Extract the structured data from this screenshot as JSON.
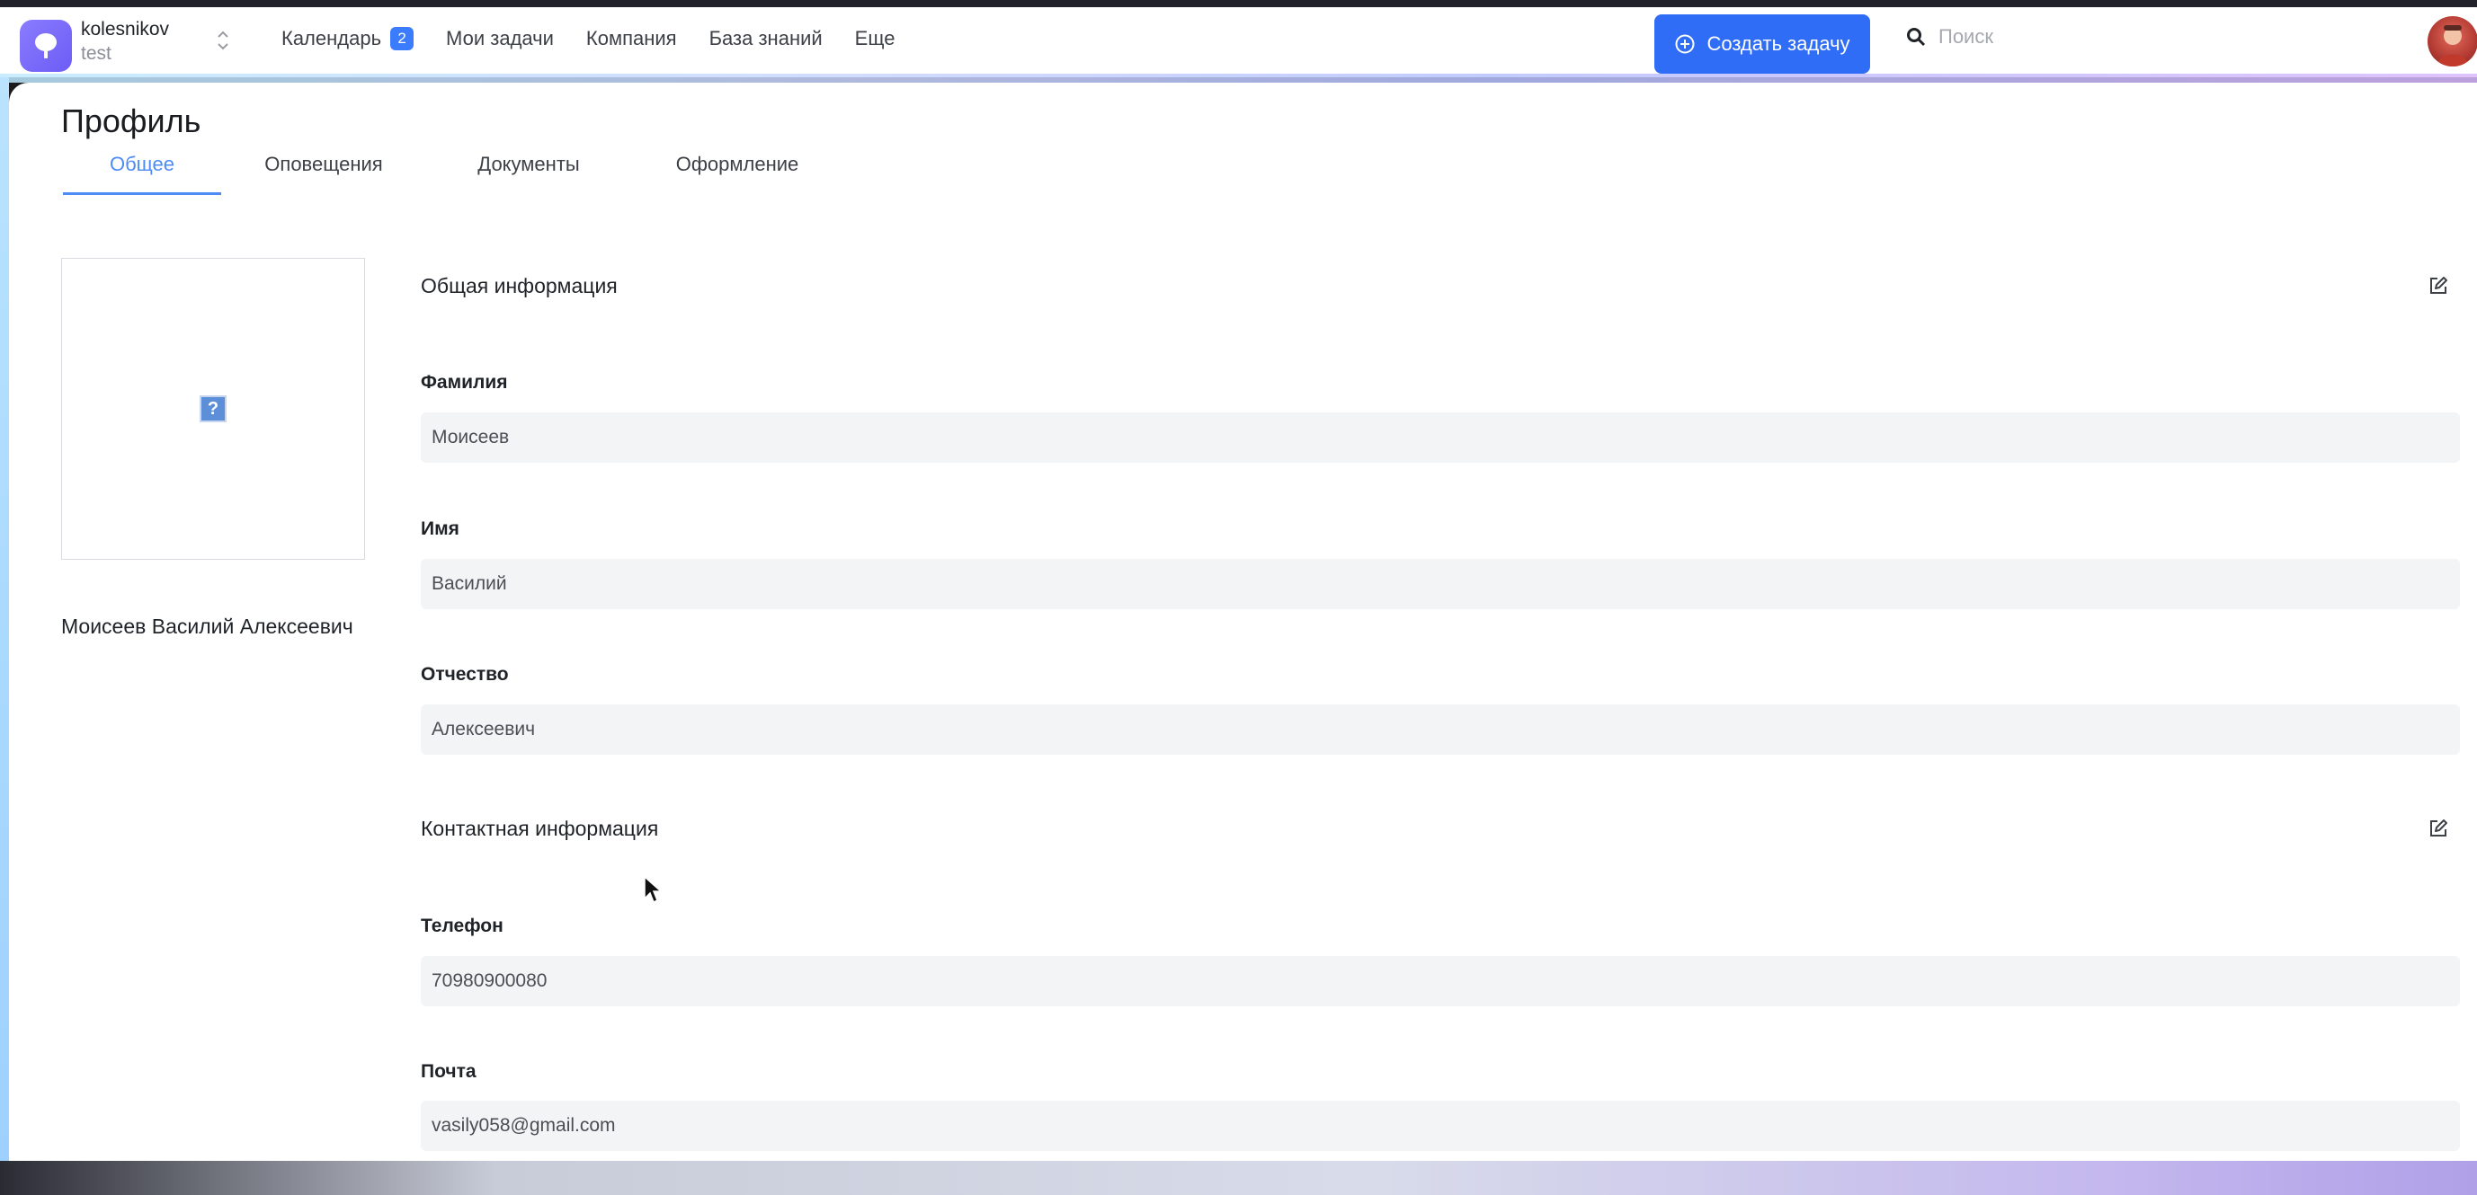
{
  "header": {
    "company_name": "kolesnikov",
    "company_sub": "test",
    "nav": [
      {
        "label": "Календарь",
        "badge": "2"
      },
      {
        "label": "Мои задачи"
      },
      {
        "label": "Компания"
      },
      {
        "label": "База знаний"
      },
      {
        "label": "Еще"
      }
    ],
    "create_label": "Создать задачу",
    "search_placeholder": "Поиск"
  },
  "page": {
    "title": "Профиль",
    "tabs": [
      "Общее",
      "Оповещения",
      "Документы",
      "Оформление"
    ],
    "active_tab": "Общее",
    "full_name": "Моисеев Василий Алексеевич"
  },
  "general": {
    "title": "Общая информация",
    "fields": [
      {
        "label": "Фамилия",
        "value": "Моисеев"
      },
      {
        "label": "Имя",
        "value": "Василий"
      },
      {
        "label": "Отчество",
        "value": "Алексеевич"
      }
    ]
  },
  "contact": {
    "title": "Контактная информация",
    "fields": [
      {
        "label": "Телефон",
        "value": "70980900080"
      },
      {
        "label": "Почта",
        "value": "vasily058@gmail.com"
      }
    ]
  },
  "colors": {
    "accent": "#2f6df6",
    "tab_active": "#4d8bf5",
    "logo": "#7b6cf8"
  },
  "icons": {
    "logo": "cloud-tree-icon",
    "switcher": "chevron-updown-icon",
    "create": "plus-circle-icon",
    "search": "search-icon",
    "edit": "edit-icon",
    "photo": "broken-image-icon",
    "cursor": "mouse-pointer-icon"
  }
}
